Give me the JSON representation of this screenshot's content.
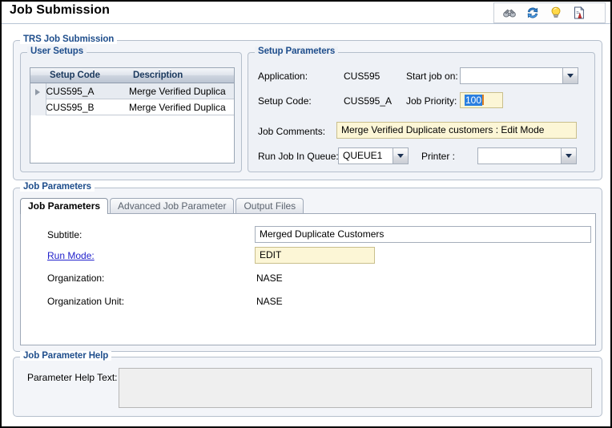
{
  "window": {
    "title": "Job Submission"
  },
  "toolbar": {
    "items": [
      {
        "name": "binoculars-icon",
        "title": "Search"
      },
      {
        "name": "refresh-icon",
        "title": "Refresh"
      },
      {
        "name": "lightbulb-icon",
        "title": "Hint"
      },
      {
        "name": "report-document-icon",
        "title": "Report"
      }
    ]
  },
  "trs_group": {
    "legend": "TRS Job Submission"
  },
  "user_setups": {
    "legend": "User Setups",
    "columns": [
      "Setup Code",
      "Description"
    ],
    "rows": [
      {
        "code": "CUS595_A",
        "description": "Merge Verified Duplica",
        "selected": true
      },
      {
        "code": "CUS595_B",
        "description": "Merge Verified Duplica",
        "selected": false
      }
    ]
  },
  "setup_parameters": {
    "legend": "Setup Parameters",
    "application_label": "Application:",
    "application_value": "CUS595",
    "setup_code_label": "Setup Code:",
    "setup_code_value": "CUS595_A",
    "start_job_on_label": "Start job on:",
    "start_job_on_value": "",
    "job_priority_label": "Job Priority:",
    "job_priority_value": "100",
    "job_comments_label": "Job Comments:",
    "job_comments_value": "Merge Verified Duplicate customers : Edit Mode",
    "run_job_in_queue_label": "Run Job In Queue:",
    "run_job_in_queue_value": "QUEUE1",
    "printer_label": "Printer :",
    "printer_value": ""
  },
  "job_parameters": {
    "legend": "Job Parameters",
    "tabs": [
      {
        "label": "Job Parameters",
        "active": true
      },
      {
        "label": "Advanced Job Parameter",
        "active": false
      },
      {
        "label": "Output Files",
        "active": false
      }
    ],
    "fields": {
      "subtitle_label": "Subtitle:",
      "subtitle_value": "Merged Duplicate Customers",
      "run_mode_label": "Run Mode:",
      "run_mode_value": "EDIT",
      "organization_label": "Organization:",
      "organization_value": "NASE",
      "organization_unit_label": "Organization Unit:",
      "organization_unit_value": "NASE"
    }
  },
  "job_parameter_help": {
    "legend": "Job Parameter Help",
    "help_text_label": "Parameter Help Text:",
    "help_text_value": ""
  },
  "colors": {
    "legend_blue": "#1f4e8c",
    "link_blue": "#2222cc",
    "selection_blue": "#2a7fe0",
    "yellow_field": "#fcf6d6",
    "panel_bg": "#eef1f6"
  }
}
